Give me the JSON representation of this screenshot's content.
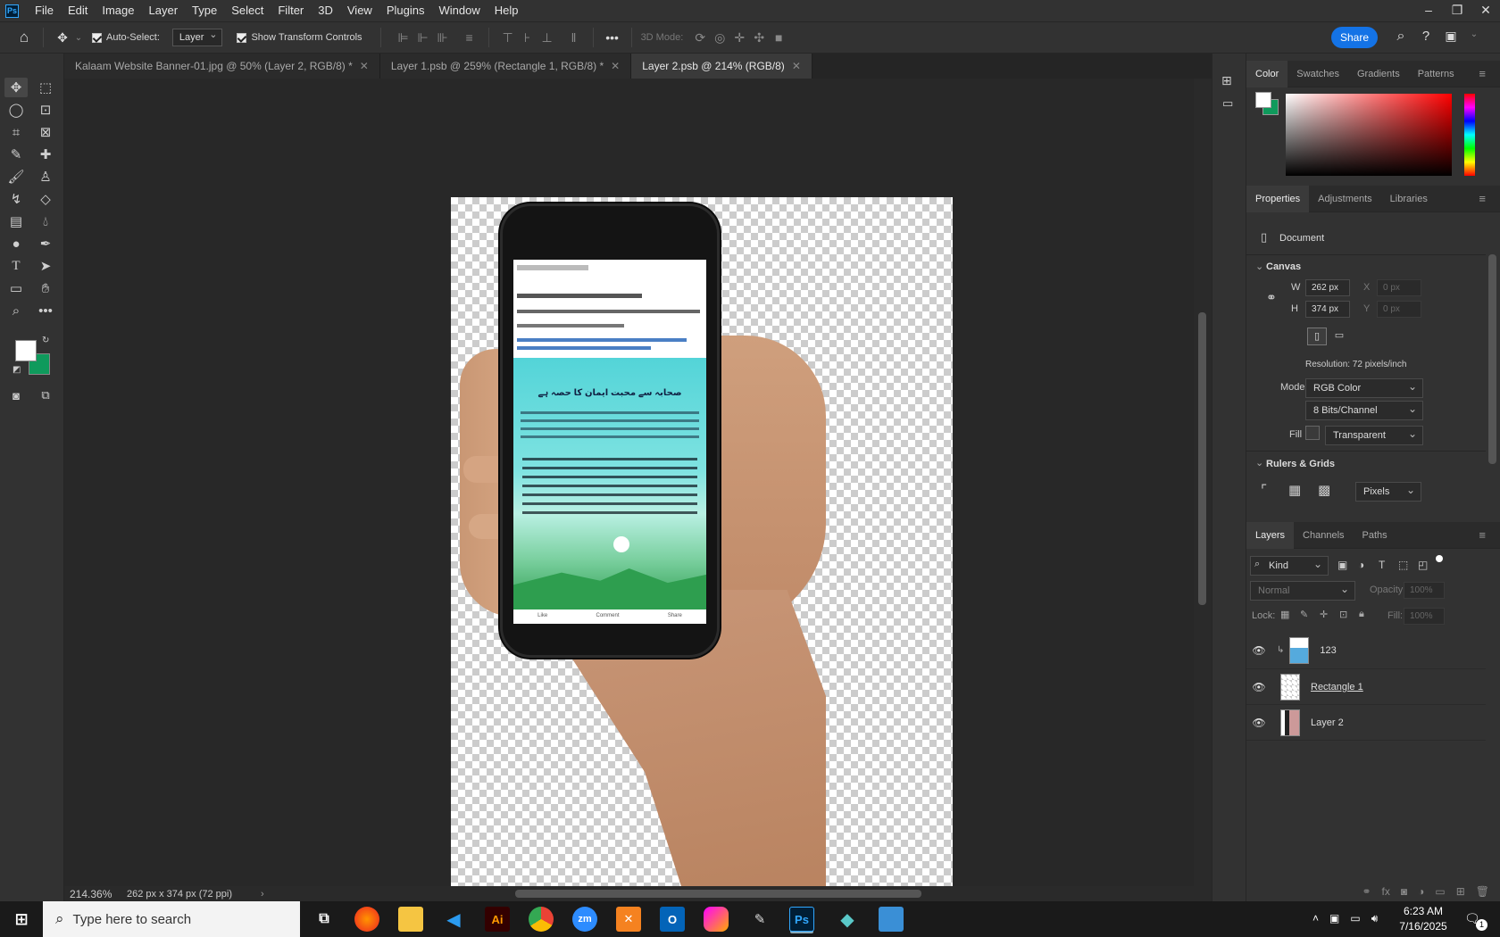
{
  "app": {
    "logo": "Ps"
  },
  "menu": [
    "File",
    "Edit",
    "Image",
    "Layer",
    "Type",
    "Select",
    "Filter",
    "3D",
    "View",
    "Plugins",
    "Window",
    "Help"
  ],
  "window_controls": {
    "minimize": "–",
    "restore": "❐",
    "close": "✕"
  },
  "options": {
    "auto_select_label": "Auto-Select:",
    "auto_select_target": "Layer",
    "transform_label": "Show Transform Controls",
    "mode_3d": "3D Mode:",
    "share": "Share"
  },
  "tabs": [
    {
      "label": "Kalaam Website Banner-01.jpg @ 50% (Layer 2, RGB/8) *"
    },
    {
      "label": "Layer 1.psb @ 259% (Rectangle 1, RGB/8) *"
    },
    {
      "label": "Layer 2.psb @ 214% (RGB/8)"
    }
  ],
  "status": {
    "zoom": "214.36%",
    "doc_size": "262 px x 374 px (72 ppi)"
  },
  "color_panel": {
    "tabs": [
      "Color",
      "Swatches",
      "Gradients",
      "Patterns"
    ],
    "fg": "#ffffff",
    "bg": "#0f9a5c"
  },
  "properties": {
    "tabs": [
      "Properties",
      "Adjustments",
      "Libraries"
    ],
    "type": "Document",
    "canvas_title": "Canvas",
    "w_label": "W",
    "w": "262 px",
    "h_label": "H",
    "h": "374 px",
    "x_label": "X",
    "x_ph": "0 px",
    "y_label": "Y",
    "y_ph": "0 px",
    "resolution": "Resolution: 72 pixels/inch",
    "mode_label": "Mode",
    "mode": "RGB Color",
    "bits": "8 Bits/Channel",
    "fill_label": "Fill",
    "fill": "Transparent",
    "rulers_title": "Rulers & Grids",
    "units": "Pixels"
  },
  "layers_panel": {
    "tabs": [
      "Layers",
      "Channels",
      "Paths"
    ],
    "filter": "Kind",
    "blend": "Normal",
    "opacity_label": "Opacity:",
    "opacity": "100%",
    "lock_label": "Lock:",
    "fill_label": "Fill:",
    "fill": "100%",
    "layers": [
      {
        "name": "123"
      },
      {
        "name": "Rectangle 1"
      },
      {
        "name": "Layer 2"
      }
    ]
  },
  "taskbar": {
    "search_placeholder": "Type here to search",
    "time": "6:23 AM",
    "date": "7/16/2025",
    "notif": "1"
  },
  "phone_post": {
    "heading": "صحابہ سے محبت ایمان کا حصہ ہے",
    "footer": [
      "Like",
      "Comment",
      "Share"
    ]
  }
}
